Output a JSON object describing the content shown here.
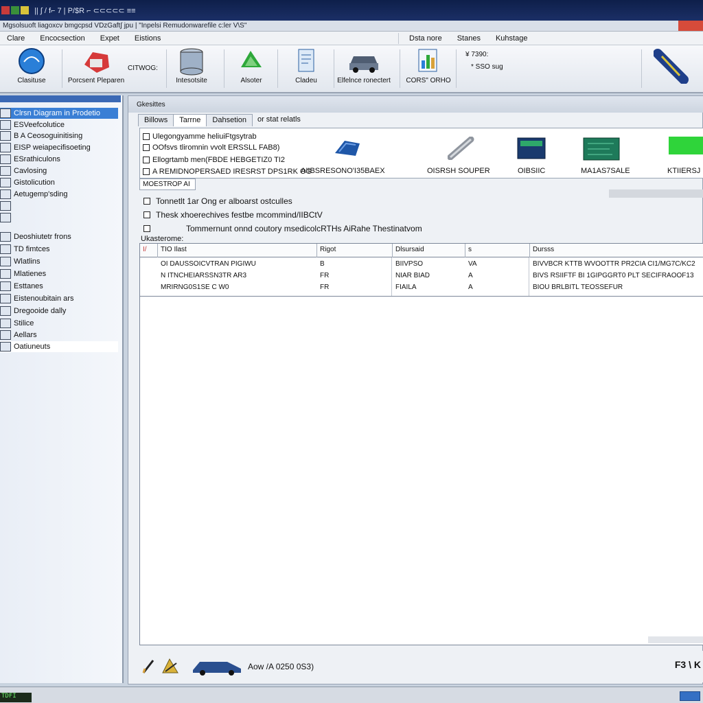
{
  "titlebar": {
    "title": "|| ∫ / f⌐ 7 | P/$R ⌐ ⊂⊂⊂⊂⊂ ≡≡"
  },
  "pathbar": {
    "path": "Mgsolsuoft liagoxcv bmgcpsd VDzGaft∫ jpu | \"Inpelsi Remudonwarefile c:ler V\\S\""
  },
  "menu": {
    "left": [
      "Clare",
      "Encocsection",
      "Expet",
      "Eistions"
    ],
    "right": [
      "Dsta nore",
      "Stanes",
      "Kuhstage"
    ]
  },
  "toolbar": {
    "tools": [
      {
        "label": "Clasituse",
        "icon": "globe-icon"
      },
      {
        "label": "Porcsent Pleparen",
        "icon": "engine-icon"
      },
      {
        "label": "Intesotsite",
        "icon": "database-icon"
      },
      {
        "label": "Alsoter",
        "icon": "recycle-icon"
      },
      {
        "label": "Cladeu",
        "icon": "document-icon"
      },
      {
        "label": "Elfelnce ronectert",
        "icon": "car-icon"
      },
      {
        "label": "CORS\" ORHO",
        "icon": "chart-icon"
      }
    ],
    "mid_status": "CITWOG:",
    "right_status": [
      "¥ 7390:",
      "* SSO sug"
    ],
    "cable_icon": "usb-cable-icon"
  },
  "sidebar": {
    "items": [
      {
        "label": "Clrsn Diagram in Prodetio",
        "selected": true
      },
      {
        "label": "ESVeefcolutice"
      },
      {
        "label": "B A Ceosoguinitising"
      },
      {
        "label": "EISP weiapecifisoeting"
      },
      {
        "label": "ESrathiculons"
      },
      {
        "label": "Cavlosing"
      },
      {
        "label": "Gistolicution"
      },
      {
        "label": "Aetugemp'sding"
      },
      {
        "label": ""
      },
      {
        "label": ""
      },
      {
        "label": "Deoshiutetr frons"
      },
      {
        "label": "TD fimtces"
      },
      {
        "label": "Wlatlins"
      },
      {
        "label": "Mlatienes"
      },
      {
        "label": "Esttanes"
      },
      {
        "label": "Eistenoubitain ars"
      },
      {
        "label": "Dregooide dally"
      },
      {
        "label": "Stilice"
      },
      {
        "label": "Aellars"
      },
      {
        "label": "Oatiuneuts",
        "selected_white": true
      }
    ]
  },
  "main": {
    "header": "Gkesittes",
    "tabs": [
      "Billows",
      "Tarrne",
      "Dahsetion",
      "or stat relatls"
    ],
    "info_lines": [
      "Ulegongyamme heliuiFtgsytrab",
      "OOfsvs  tliromnin vvolt ERSSLL FAB8)",
      "Ellogrtamb men(FBDE HEBGETIZ0  TI2",
      "A  REMIDNOPERSAED IRESRST DPS1RK OG"
    ],
    "components": [
      {
        "label": "AIIBSRESONO'I35BAEX",
        "icon": "sensor-icon"
      },
      {
        "label": "OISRSH SOUPER",
        "icon": "injector-icon"
      },
      {
        "label": "OIBSIIC",
        "icon": "ecu-module-icon"
      },
      {
        "label": "MA1AS7SALE",
        "icon": "circuit-board-icon"
      },
      {
        "label": "KTIIERSJ",
        "icon": "green-module-icon"
      }
    ],
    "field": "MOESTROP AI",
    "options": [
      "Tonnetlt 1ar Ong er alboarst ostculles",
      "Thesk xhoerechives festbe mcommind/IIBCtV",
      "Tommernunt onnd coutory msedicolcRTHs AiRahe Thestinatvom"
    ],
    "section_label": "Ukasterome:",
    "grid": {
      "columns": [
        "I/",
        "TIO Ilast",
        "Rigot",
        "Dlsursaid",
        "s",
        "Dursss"
      ],
      "rows": [
        [
          "OI DAUSSOICVTRAN PIGIWU",
          "B",
          "BIIVPSO",
          "VA",
          "BIVVBCR KTTB WVOOTTR PR2CIA CI1/MG7C/KC2"
        ],
        [
          "N ITNCHEIARSSN3TR AR3",
          "FR",
          "NIAR  BIAD",
          "A",
          "BIVS RSIIFTF BI 1GIPGGRT0 PLT SECIFRAOOF13"
        ],
        [
          "MRIRNG0S1SE C W0",
          "FR",
          "FIAILA",
          "A",
          "BIOU BRLBITL TEOSSEFUR"
        ]
      ]
    }
  },
  "bottom": {
    "text": "Aow /A 0250 0S3)",
    "right_text": "F3 \\ K",
    "icons": [
      "pencil-icon",
      "tools-icon",
      "car-icon"
    ]
  },
  "statusbar": {
    "led": "TDFI"
  },
  "colors": {
    "accent": "#3a7fd5",
    "title_bar": "#0e1f4a",
    "close": "#d64b3a"
  }
}
